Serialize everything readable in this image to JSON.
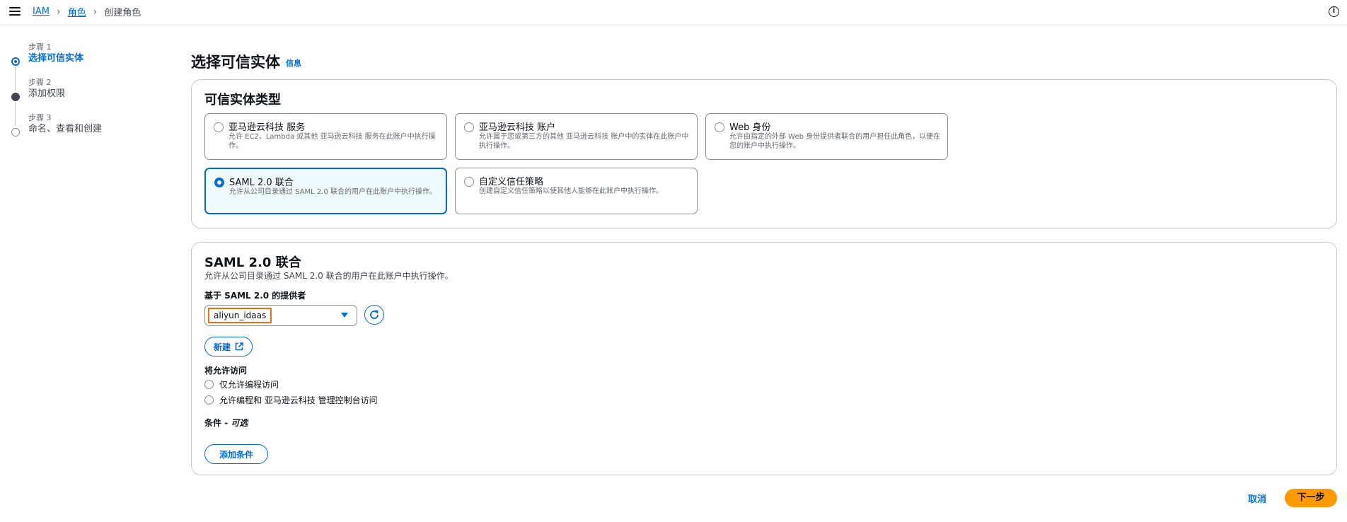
{
  "breadcrumb": {
    "home": "IAM",
    "roles": "角色",
    "current": "创建角色"
  },
  "steps": [
    {
      "num": "步骤 1",
      "label": "选择可信实体"
    },
    {
      "num": "步骤 2",
      "label": "添加权限"
    },
    {
      "num": "步骤 3",
      "label": "命名、查看和创建"
    }
  ],
  "page": {
    "title": "选择可信实体",
    "info_link": "信息"
  },
  "entity_types": {
    "title": "可信实体类型",
    "tiles": [
      {
        "title": "亚马逊云科技 服务",
        "desc": "允许 EC2、Lambda 或其他 亚马逊云科技 服务在此账户中执行操作。",
        "selected": false
      },
      {
        "title": "亚马逊云科技 账户",
        "desc": "允许属于您或第三方的其他 亚马逊云科技 账户中的实体在此账户中执行操作。",
        "selected": false
      },
      {
        "title": "Web 身份",
        "desc": "允许由指定的外部 Web 身份提供者联合的用户担任此角色，以便在您的账户中执行操作。",
        "selected": false
      },
      {
        "title": "SAML 2.0 联合",
        "desc": "允许从公司目录通过 SAML 2.0 联合的用户在此账户中执行操作。",
        "selected": true
      },
      {
        "title": "自定义信任策略",
        "desc": "创建自定义信任策略以使其他人能够在此账户中执行操作。",
        "selected": false
      }
    ]
  },
  "saml": {
    "title": "SAML 2.0 联合",
    "desc": "允许从公司目录通过 SAML 2.0 联合的用户在此账户中执行操作。",
    "provider_label": "基于 SAML 2.0 的提供者",
    "provider_value": "aliyun_idaas",
    "new_button": "新建",
    "access_label": "将允许访问",
    "access_options": [
      "仅允许编程访问",
      "允许编程和 亚马逊云科技 管理控制台访问"
    ],
    "condition_label": "条件 - ",
    "condition_optional": "可选",
    "add_condition_button": "添加条件"
  },
  "footer": {
    "cancel": "取消",
    "next": "下一步"
  },
  "colors": {
    "accent": "#006ce0",
    "primary_button": "#ff9900",
    "highlight": "#ec7211"
  }
}
